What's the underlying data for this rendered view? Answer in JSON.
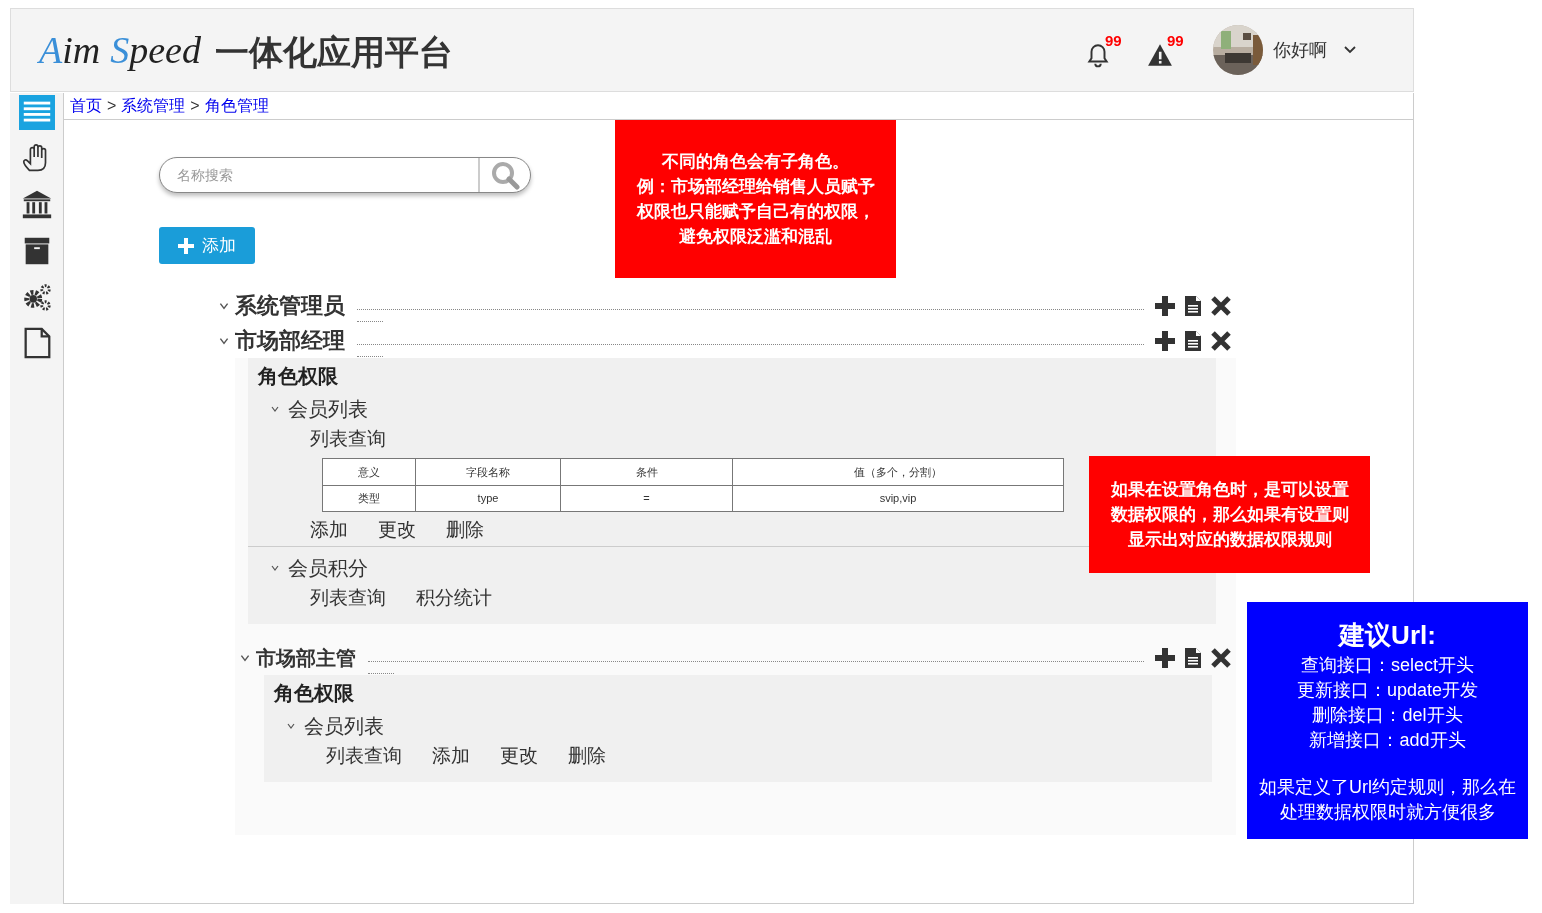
{
  "header": {
    "logo": [
      {
        "text": "A",
        "color": "#3a8fd8"
      },
      {
        "text": "im",
        "color": "#222222"
      },
      {
        "text": "S",
        "color": "#3a8fd8"
      },
      {
        "text": "peed",
        "color": "#222222"
      }
    ],
    "title": "一体化应用平台",
    "alerts": [
      {
        "kind": "bell",
        "badge": "99"
      },
      {
        "kind": "warning",
        "badge": "99"
      }
    ],
    "user": {
      "name": "你好啊"
    }
  },
  "sidebar": {
    "items": [
      {
        "kind": "menu",
        "selected": true
      },
      {
        "kind": "hand",
        "selected": false
      },
      {
        "kind": "bank",
        "selected": false
      },
      {
        "kind": "archive",
        "selected": false
      },
      {
        "kind": "gears",
        "selected": false
      },
      {
        "kind": "file",
        "selected": false
      }
    ]
  },
  "breadcrumb": {
    "items": [
      "首页",
      "系统管理",
      "角色管理"
    ],
    "separator": ">"
  },
  "search": {
    "placeholder": "名称搜索"
  },
  "add_button": {
    "label": "添加"
  },
  "roles": [
    {
      "name": "系统管理员"
    },
    {
      "name": "市场部经理",
      "permissions": {
        "title": "角色权限",
        "groups": [
          {
            "name": "会员列表",
            "lines": [
              {
                "kind": "ops",
                "labels": [
                  "列表查询"
                ]
              },
              {
                "kind": "table",
                "columns": [
                  "意义",
                  "字段名称",
                  "条件",
                  "值（多个，分割）"
                ],
                "rows": [
                  [
                    "类型",
                    "type",
                    "=",
                    "svip,vip"
                  ]
                ]
              },
              {
                "kind": "ops",
                "labels": [
                  "添加",
                  "更改",
                  "删除"
                ]
              }
            ]
          },
          {
            "name": "会员积分",
            "lines": [
              {
                "kind": "ops",
                "labels": [
                  "列表查询",
                  "积分统计"
                ]
              }
            ]
          }
        ]
      },
      "children": [
        {
          "name": "市场部主管",
          "permissions": {
            "title": "角色权限",
            "groups": [
              {
                "name": "会员列表",
                "lines": [
                  {
                    "kind": "ops",
                    "labels": [
                      "列表查询",
                      "添加",
                      "更改",
                      "删除"
                    ]
                  }
                ]
              }
            ]
          }
        }
      ]
    }
  ],
  "notes": [
    {
      "color": "#ff0000",
      "lines": [
        "不同的角色会有子角色。",
        "例：市场部经理给销售人员赋予",
        "权限也只能赋予自己有的权限，",
        "避免权限泛滥和混乱"
      ]
    },
    {
      "color": "#ff0000",
      "lines": [
        "如果在设置角色时，是可以设置",
        "数据权限的，那么如果有设置则",
        "显示出对应的数据权限规则"
      ]
    },
    {
      "color": "#0000ff",
      "title": "建议Url:",
      "lines": [
        "查询接口：select开头",
        "更新接口：update开发",
        "删除接口：del开头",
        "新增接口：add开头"
      ],
      "footer_lines": [
        "如果定义了Url约定规则，那么在",
        "处理数据权限时就方便很多"
      ]
    }
  ]
}
